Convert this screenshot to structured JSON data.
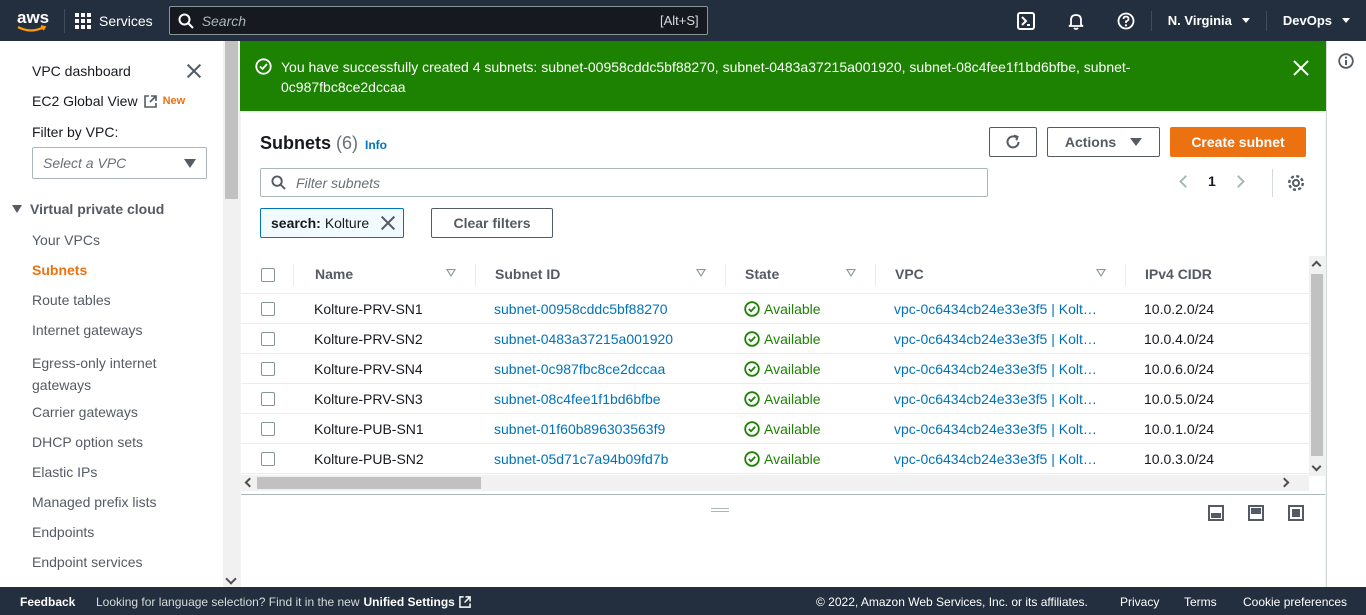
{
  "topnav": {
    "logo_text": "aws",
    "services_label": "Services",
    "search_placeholder": "Search",
    "search_shortcut": "[Alt+S]",
    "region": "N. Virginia",
    "account": "DevOps"
  },
  "sidebar": {
    "dashboard": "VPC dashboard",
    "ec2_global_view": "EC2 Global View",
    "new_badge": "New",
    "filter_label": "Filter by VPC:",
    "vpc_select_placeholder": "Select a VPC",
    "section": "Virtual private cloud",
    "items": [
      "Your VPCs",
      "Subnets",
      "Route tables",
      "Internet gateways",
      "Egress-only internet gateways",
      "Carrier gateways",
      "DHCP option sets",
      "Elastic IPs",
      "Managed prefix lists",
      "Endpoints",
      "Endpoint services"
    ],
    "active_item": "Subnets"
  },
  "flash": {
    "message": "You have successfully created 4 subnets: subnet-00958cddc5bf88270, subnet-0483a37215a001920, subnet-08c4fee1f1bd6bfbe, subnet-0c987fbc8ce2dccaa"
  },
  "panel": {
    "title": "Subnets",
    "count": "(6)",
    "info": "Info",
    "actions_label": "Actions",
    "create_label": "Create subnet",
    "filter_placeholder": "Filter subnets",
    "page": "1",
    "token_key": "search:",
    "token_value": "Kolture",
    "clear_filters": "Clear filters"
  },
  "table": {
    "columns": [
      "Name",
      "Subnet ID",
      "State",
      "VPC",
      "IPv4 CIDR"
    ],
    "rows": [
      {
        "name": "Kolture-PRV-SN1",
        "id": "subnet-00958cddc5bf88270",
        "state": "Available",
        "vpc": "vpc-0c6434cb24e33e3f5 | Kolt…",
        "cidr": "10.0.2.0/24"
      },
      {
        "name": "Kolture-PRV-SN2",
        "id": "subnet-0483a37215a001920",
        "state": "Available",
        "vpc": "vpc-0c6434cb24e33e3f5 | Kolt…",
        "cidr": "10.0.4.0/24"
      },
      {
        "name": "Kolture-PRV-SN4",
        "id": "subnet-0c987fbc8ce2dccaa",
        "state": "Available",
        "vpc": "vpc-0c6434cb24e33e3f5 | Kolt…",
        "cidr": "10.0.6.0/24"
      },
      {
        "name": "Kolture-PRV-SN3",
        "id": "subnet-08c4fee1f1bd6bfbe",
        "state": "Available",
        "vpc": "vpc-0c6434cb24e33e3f5 | Kolt…",
        "cidr": "10.0.5.0/24"
      },
      {
        "name": "Kolture-PUB-SN1",
        "id": "subnet-01f60b896303563f9",
        "state": "Available",
        "vpc": "vpc-0c6434cb24e33e3f5 | Kolt…",
        "cidr": "10.0.1.0/24"
      },
      {
        "name": "Kolture-PUB-SN2",
        "id": "subnet-05d71c7a94b09fd7b",
        "state": "Available",
        "vpc": "vpc-0c6434cb24e33e3f5 | Kolt…",
        "cidr": "10.0.3.0/24"
      }
    ]
  },
  "footer": {
    "feedback": "Feedback",
    "language_text": "Looking for language selection? Find it in the new",
    "unified_settings": "Unified Settings",
    "copyright": "© 2022, Amazon Web Services, Inc. or its affiliates.",
    "privacy": "Privacy",
    "terms": "Terms",
    "cookies": "Cookie preferences"
  },
  "colors": {
    "nav_bg": "#232f3e",
    "flash_success": "#1d8102",
    "accent_orange": "#ec7211",
    "link_blue": "#0073bb"
  },
  "icons": [
    "aws-logo",
    "services-grid-icon",
    "search-icon",
    "cloudshell-icon",
    "bell-icon",
    "help-icon",
    "close-icon",
    "external-link-icon",
    "check-circle-icon",
    "refresh-icon",
    "settings-icon",
    "info-icon"
  ]
}
